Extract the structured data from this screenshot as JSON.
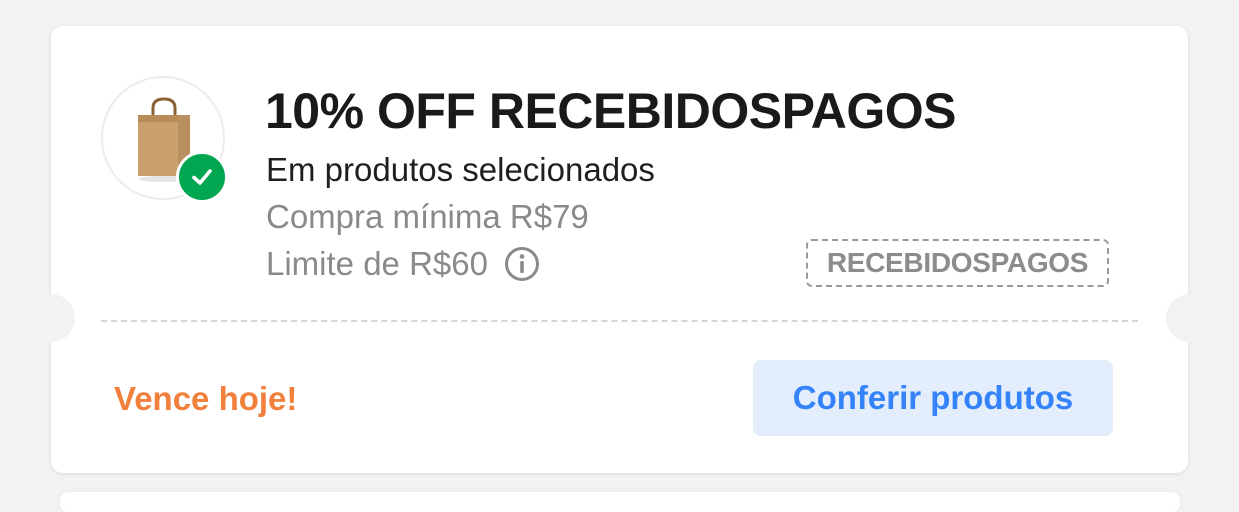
{
  "coupon": {
    "title": "10% OFF RECEBIDOSPAGOS",
    "subtitle": "Em produtos selecionados",
    "min_purchase": "Compra mínima R$79",
    "limit": "Limite de R$60",
    "code": "RECEBIDOSPAGOS",
    "expiry": "Vence hoje!",
    "cta_label": "Conferir produtos",
    "thumbnail_icon": "shopping-bag-icon",
    "status_icon": "check-icon",
    "info_icon": "info-icon"
  },
  "colors": {
    "page_bg": "#f2f2f2",
    "card_bg": "#ffffff",
    "check_green": "#00a650",
    "expiry_orange": "#f0803c",
    "cta_blue": "#3483fa",
    "cta_bg": "#e3edfb",
    "muted_text": "#8a8a8a"
  }
}
